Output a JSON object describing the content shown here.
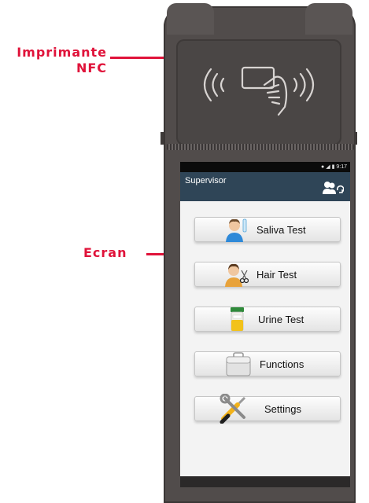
{
  "annotations": {
    "printer_label_line1": "Imprimante",
    "printer_label_line2": "NFC",
    "screen_label": "Ecran"
  },
  "status_bar": {
    "time": "9:17",
    "icons": [
      "location-icon",
      "wifi-icon",
      "battery-icon"
    ]
  },
  "app_bar": {
    "title": "Supervisor",
    "icon": "switch-user-icon"
  },
  "menu": [
    {
      "label": "Saliva Test",
      "icon": "saliva-test-icon"
    },
    {
      "label": "Hair Test",
      "icon": "hair-test-icon"
    },
    {
      "label": "Urine Test",
      "icon": "urine-test-icon"
    },
    {
      "label": "Functions",
      "icon": "briefcase-icon"
    },
    {
      "label": "Settings",
      "icon": "tools-icon"
    }
  ],
  "colors": {
    "annotation_red": "#e0133a",
    "app_bar": "#2f4557",
    "device_body": "#514c4b"
  }
}
